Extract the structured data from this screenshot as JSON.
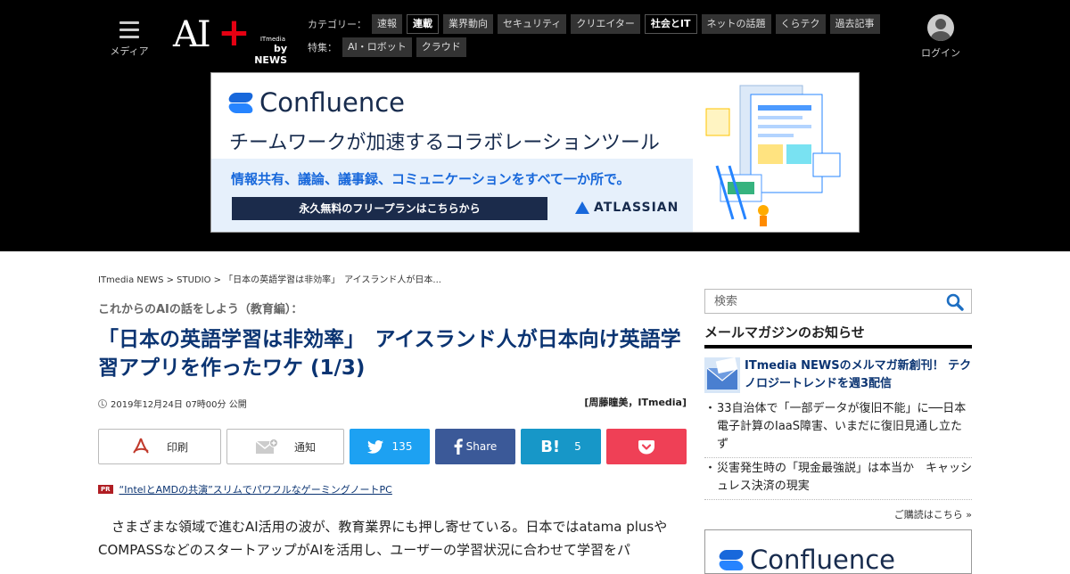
{
  "header": {
    "menu_label": "メディア",
    "logo": {
      "main": "AI",
      "plus": "+",
      "by": "ITmedia",
      "news": "by NEWS"
    },
    "category_label": "カテゴリー：",
    "categories": [
      "速報",
      "連載",
      "業界動向",
      "セキュリティ",
      "クリエイター",
      "社会とIT",
      "ネットの話題",
      "くらテク",
      "過去記事"
    ],
    "feature_label": "特集：",
    "features": [
      "AI・ロボット",
      "クラウド"
    ],
    "login_label": "ログイン"
  },
  "ad": {
    "brand": "Confluence",
    "headline": "チームワークが加速するコラボレーションツール",
    "sub": "情報共有、議論、議事録、コミュニケーションをすべて一か所で。",
    "cta": "永久無料のフリープランはこちらから",
    "partner": "ATLASSIAN"
  },
  "article": {
    "breadcrumb": "ITmedia NEWS > STUDIO > 「日本の英語学習は非効率」　アイスランド人が日本...",
    "kicker": "これからのAIの話をしよう（教育編）：",
    "title": "「日本の英語学習は非効率」　アイスランド人が日本向け英語学習アプリを作ったワケ (1/3)",
    "date": "2019年12月24日 07時00分 公開",
    "byline": "[周藤瞳美，ITmedia]",
    "share": {
      "print": "印刷",
      "notify": "通知",
      "twitter_count": "135",
      "facebook": "Share",
      "hatena_count": "5"
    },
    "pr_badge": "PR",
    "pr_text": "“IntelとAMDの共演”スリムでパワフルなゲーミングノートPC",
    "body": "さまざまな領域で進むAI活用の波が、教育業界にも押し寄せている。日本ではatama plusやCOMPASSなどのスタートアップがAIを活用し、ユーザーの学習状況に合わせて学習をパ"
  },
  "sidebar": {
    "search_placeholder": "検索",
    "mailmag_title": "メールマガジンのお知らせ",
    "feature": "ITmedia NEWSのメルマガ新創刊！ テクノロジートレンドを週3配信",
    "items": [
      "33自治体で「一部データが復旧不能」に──日本電子計算のIaaS障害、いまだに復旧見通し立たず",
      "災害発生時の「現金最強説」は本当か　キャッシュレス決済の現実"
    ],
    "subscribe": "ご購読はこちら »",
    "ad_brand": "Confluence"
  },
  "colors": {
    "header_bg": "#000000",
    "title_blue": "#0b3472",
    "twitter": "#1da1f2",
    "facebook": "#3b5998",
    "hatena": "#1797c8",
    "pocket": "#ef4056",
    "logo_red": "#e60012",
    "confluence_blue": "#1868db"
  }
}
